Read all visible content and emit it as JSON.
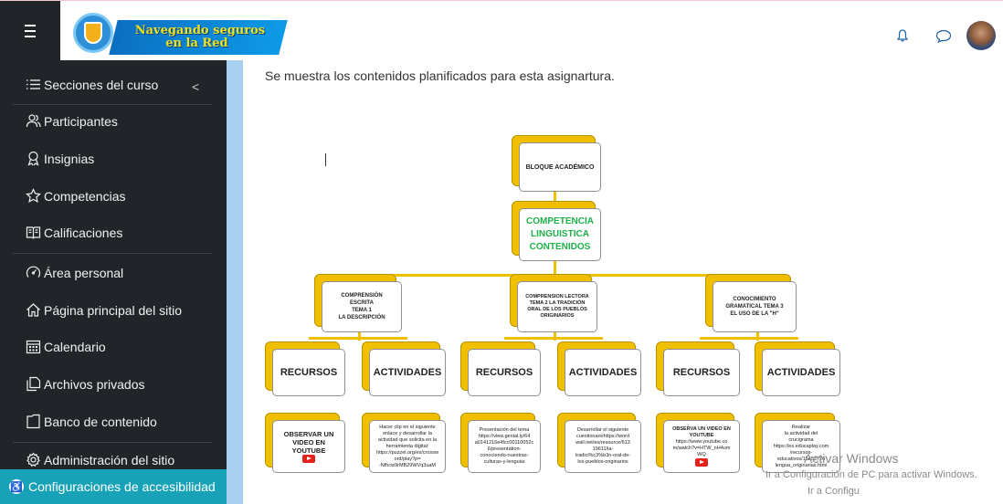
{
  "header": {
    "logo_line1": "Navegando seguros",
    "logo_line2": "en la Red",
    "icons": [
      "menu-icon",
      "bell-icon",
      "chat-icon"
    ]
  },
  "sidebar": {
    "items": [
      {
        "label": "Secciones del curso",
        "icon": "list-icon"
      },
      {
        "label": "Participantes",
        "icon": "users-icon"
      },
      {
        "label": "Insignias",
        "icon": "badge-icon"
      },
      {
        "label": "Competencias",
        "icon": "star-icon"
      },
      {
        "label": "Calificaciones",
        "icon": "book-icon"
      },
      {
        "label": "Área personal",
        "icon": "dashboard-icon"
      },
      {
        "label": "Página principal del sitio",
        "icon": "home-icon"
      },
      {
        "label": "Calendario",
        "icon": "calendar-icon"
      },
      {
        "label": "Archivos privados",
        "icon": "files-icon"
      },
      {
        "label": "Banco de contenido",
        "icon": "folder-icon"
      },
      {
        "label": "Administración del sitio",
        "icon": "gear-icon"
      }
    ],
    "collapse_glyph": "<",
    "accessibility": "Configuraciones de accesibilidad"
  },
  "main": {
    "intro": "Se muestra los contenidos planificados para esta asignartura.",
    "diagram": {
      "root": "BLOQUE ACADÉMICO",
      "level2": [
        "COMPETENCIA",
        "LINGUISTICA",
        "CONTENIDOS"
      ],
      "topics": [
        [
          "COMPRENSIÓN",
          "ESCRITA",
          "TEMA 1",
          "LA DESCRIPCIÓN"
        ],
        [
          "COMPRENSION LECTORA",
          "TEMA 2 LA TRADICIÓN",
          "ORAL DE LOS PUEBLOS",
          "ORIGINARIOS"
        ],
        [
          "CONOCIMIENTO",
          "GRAMATICAL TEMA 3",
          "EL USO DE LA \"H\""
        ]
      ],
      "resources_label": "RECURSOS",
      "activities_label": "ACTIVIDADES",
      "leaves": [
        [
          "OBSERVAR UN",
          "VIDEO EN",
          "YOUTUBE"
        ],
        [
          "Hacer clip en el siguiente",
          "enlace y desarrollar la",
          "actividad que solicita en la",
          "herramienta digital:",
          "https://puzzel.org/es/crossw",
          "ord/play?p=",
          "-Nfhcw9rMB29WVq3uaM"
        ],
        [
          "Presentación del tema",
          "https://view.genial.ly/64",
          "a0141216e4fcc00110052c",
          "6/presentation-",
          "conociendo-nuestras-",
          "culturas-y-lenguas"
        ],
        [
          "Desarrollar el siguiente",
          "cuestionariohttps://word",
          "wall.net/es/resource/613",
          "19611/la-",
          "tradici%c3%b3n-oral-de-",
          "los-pueblos-originarios"
        ],
        [
          "OBSERVA UN VIDEO EN",
          "YOUTUBE",
          "https://www.youtube.co",
          "m/watch?v=HTW_nH4um",
          "WQ"
        ],
        [
          "Realizar",
          "la actividad del",
          "crucigrama",
          "https://es.educaplay.com",
          "/recursos-",
          "educativos/15453726",
          "lengua_originarias.html"
        ]
      ]
    }
  },
  "watermark": {
    "line1": "Activar Windows",
    "line2": "Ir a Configuración de PC para activar Windows.",
    "line3": "Ir a Configu"
  }
}
